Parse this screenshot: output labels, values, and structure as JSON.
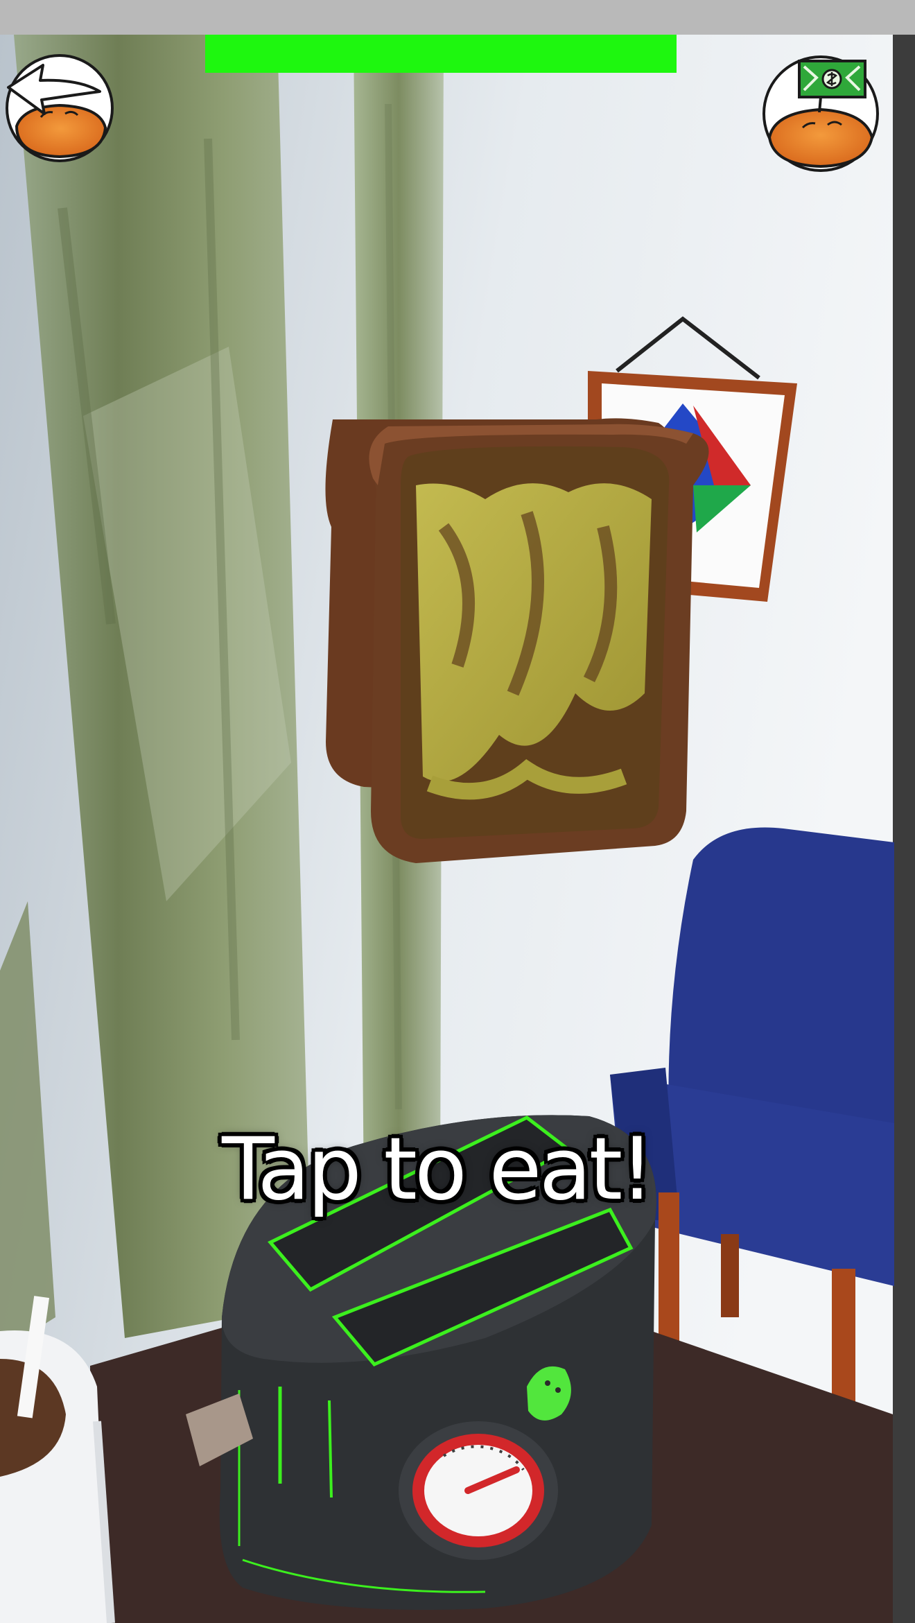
{
  "hud": {
    "prompt_text": "Tap to eat!",
    "progress_fraction": 1.0,
    "progress_color": "#1ef70f"
  },
  "buttons": {
    "back": {
      "icon": "back-arrow-bread-icon"
    },
    "shop": {
      "icon": "cash-bread-icon"
    }
  },
  "colors": {
    "top_bar": "#b9b9b9",
    "right_edge": "#3c3c3c",
    "wall": "#dde4ea",
    "curtain": "#8a9a70",
    "toast_crust": "#6b3d22",
    "toast_topping": "#b3a93c",
    "chair": "#27388d",
    "chair_legs": "#a9481c",
    "table": "#3d2a27",
    "toaster": "#2e3134",
    "toaster_accent": "#3cf01e"
  }
}
